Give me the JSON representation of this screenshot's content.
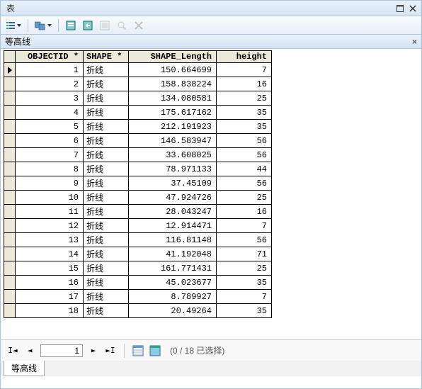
{
  "window": {
    "title": "表",
    "subtitle": "等高线"
  },
  "columns": {
    "objectid": "OBJECTID *",
    "shape": "SHAPE *",
    "length": "SHAPE_Length",
    "height": "height"
  },
  "rows": [
    {
      "objectid": "1",
      "shape": "折线",
      "length": "150.664699",
      "height": "7"
    },
    {
      "objectid": "2",
      "shape": "折线",
      "length": "158.838224",
      "height": "16"
    },
    {
      "objectid": "3",
      "shape": "折线",
      "length": "134.080581",
      "height": "25"
    },
    {
      "objectid": "4",
      "shape": "折线",
      "length": "175.617162",
      "height": "35"
    },
    {
      "objectid": "5",
      "shape": "折线",
      "length": "212.191923",
      "height": "35"
    },
    {
      "objectid": "6",
      "shape": "折线",
      "length": "146.583947",
      "height": "56"
    },
    {
      "objectid": "7",
      "shape": "折线",
      "length": "33.608025",
      "height": "56"
    },
    {
      "objectid": "8",
      "shape": "折线",
      "length": "78.971133",
      "height": "44"
    },
    {
      "objectid": "9",
      "shape": "折线",
      "length": "37.45109",
      "height": "56"
    },
    {
      "objectid": "10",
      "shape": "折线",
      "length": "47.924726",
      "height": "25"
    },
    {
      "objectid": "11",
      "shape": "折线",
      "length": "28.043247",
      "height": "16"
    },
    {
      "objectid": "12",
      "shape": "折线",
      "length": "12.914471",
      "height": "7"
    },
    {
      "objectid": "13",
      "shape": "折线",
      "length": "116.81148",
      "height": "56"
    },
    {
      "objectid": "14",
      "shape": "折线",
      "length": "41.192048",
      "height": "71"
    },
    {
      "objectid": "15",
      "shape": "折线",
      "length": "161.771431",
      "height": "25"
    },
    {
      "objectid": "16",
      "shape": "折线",
      "length": "45.023677",
      "height": "35"
    },
    {
      "objectid": "17",
      "shape": "折线",
      "length": "8.789927",
      "height": "7"
    },
    {
      "objectid": "18",
      "shape": "折线",
      "length": "20.49264",
      "height": "35"
    }
  ],
  "nav": {
    "current": "1",
    "status": "(0 / 18 已选择)"
  },
  "tab": {
    "label": "等高线"
  }
}
